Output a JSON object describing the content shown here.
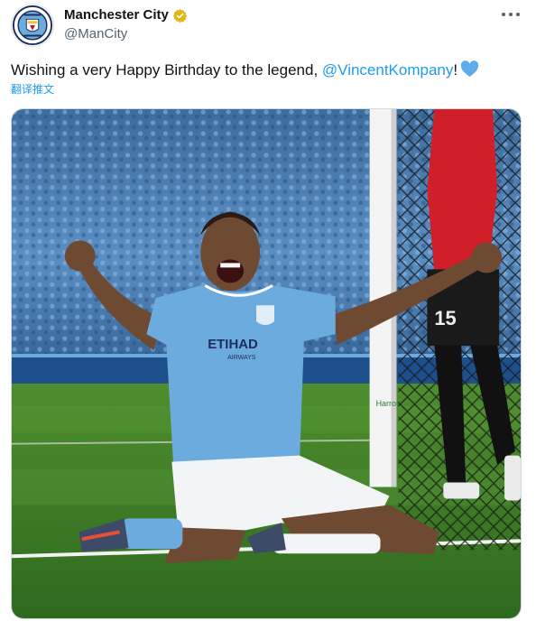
{
  "account": {
    "display_name": "Manchester City",
    "handle": "@ManCity",
    "avatar_icon": "manchester-city-crest-icon",
    "verified_icon": "gold-verified-badge-icon",
    "verified_color": "#e2b719"
  },
  "tweet": {
    "text_before": "Wishing a very Happy Birthday to the legend, ",
    "mention": "@VincentKompany",
    "text_after": "!",
    "emoji_icon": "blue-heart-icon",
    "translate_label": "翻译推文"
  },
  "media": {
    "description_icon": "celebrating-footballer-photo",
    "shirt_sponsor": "ETIHAD",
    "shirt_sponsor_sub": "AIRWAYS",
    "opponent_number": "15",
    "post_sign": "Harrod"
  },
  "colors": {
    "link": "#1d9bf0",
    "text": "#0f1419",
    "secondary": "#536471",
    "city_blue": "#6cabdd"
  }
}
